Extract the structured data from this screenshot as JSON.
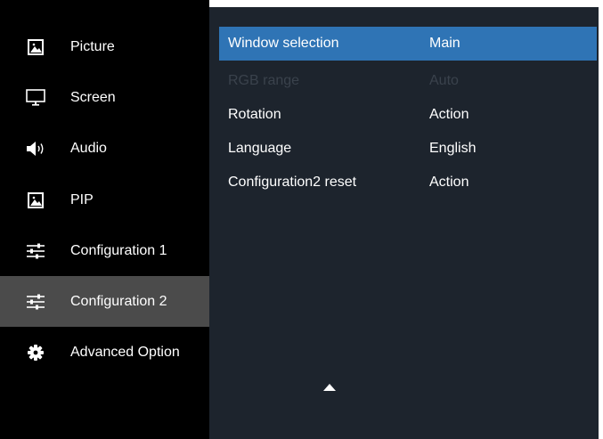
{
  "sidebar": {
    "items": [
      {
        "label": "Picture",
        "icon": "picture-icon"
      },
      {
        "label": "Screen",
        "icon": "monitor-icon"
      },
      {
        "label": "Audio",
        "icon": "speaker-icon"
      },
      {
        "label": "PIP",
        "icon": "picture-icon"
      },
      {
        "label": "Configuration 1",
        "icon": "sliders-icon"
      },
      {
        "label": "Configuration 2",
        "icon": "sliders-icon",
        "selected": true
      },
      {
        "label": "Advanced Option",
        "icon": "gear-icon"
      }
    ]
  },
  "panel": {
    "rows": [
      {
        "label": "Window selection",
        "value": "Main",
        "state": "highlighted"
      },
      {
        "label": "RGB range",
        "value": "Auto",
        "state": "disabled"
      },
      {
        "label": "Rotation",
        "value": "Action",
        "state": "normal"
      },
      {
        "label": "Language",
        "value": "English",
        "state": "normal"
      },
      {
        "label": "Configuration2 reset",
        "value": "Action",
        "state": "normal"
      }
    ],
    "scroll_icon": "triangle-up-icon"
  },
  "colors": {
    "sidebar_bg": "#000000",
    "sidebar_selected_bg": "#4b4b4b",
    "panel_bg": "#1d242d",
    "highlight_bg": "#2f74b5",
    "text": "#ffffff",
    "disabled_text": "#3a424c"
  }
}
